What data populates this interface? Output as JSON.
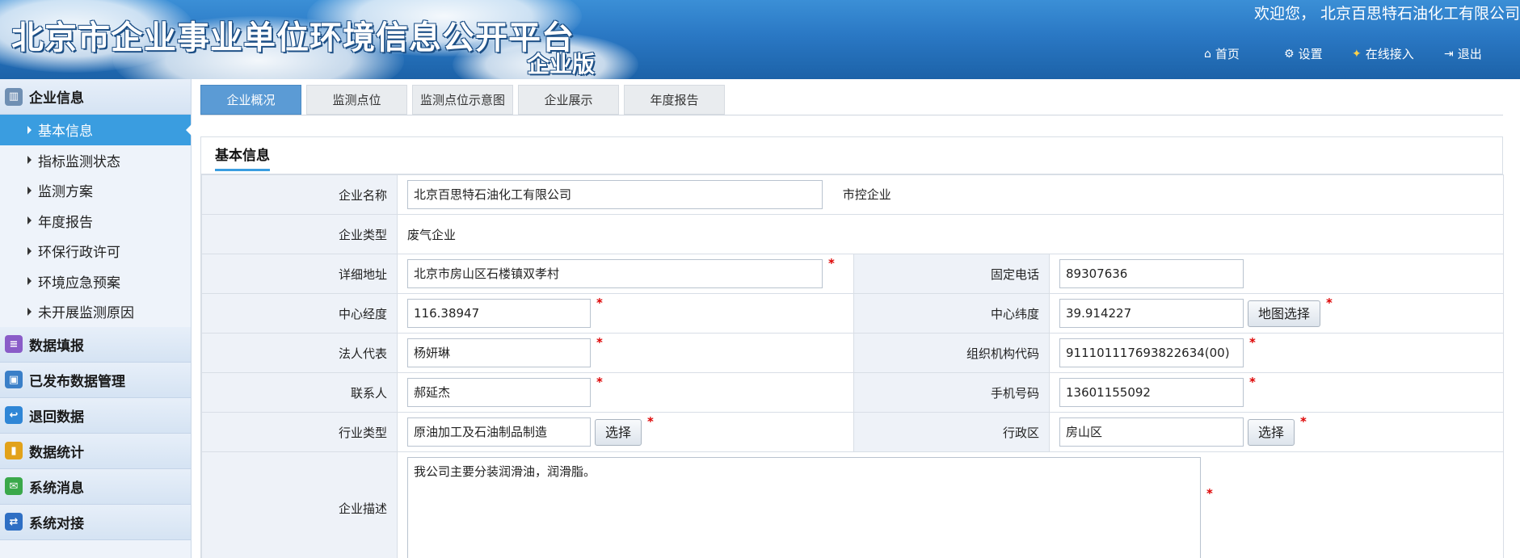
{
  "header": {
    "title": "北京市企业事业单位环境信息公开平台",
    "subtitle": "企业版",
    "welcome": "欢迎您， 北京百思特石油化工有限公司",
    "nav": [
      {
        "label": "首页",
        "icon": "home-icon"
      },
      {
        "label": "设置",
        "icon": "gear-icon"
      },
      {
        "label": "在线接入",
        "icon": "online-access-icon"
      },
      {
        "label": "退出",
        "icon": "logout-icon"
      }
    ]
  },
  "sidebar": {
    "sections": [
      {
        "label": "企业信息",
        "icon": "enterprise-info-icon",
        "color": "#6f8fb3"
      },
      {
        "label": "数据填报",
        "icon": "data-report-icon",
        "color": "#8a5cc8"
      },
      {
        "label": "已发布数据管理",
        "icon": "published-data-icon",
        "color": "#3a7fc8"
      },
      {
        "label": "退回数据",
        "icon": "returned-data-icon",
        "color": "#2f86d6"
      },
      {
        "label": "数据统计",
        "icon": "statistics-icon",
        "color": "#e2a21a"
      },
      {
        "label": "系统消息",
        "icon": "message-icon",
        "color": "#3aa84a"
      },
      {
        "label": "系统对接",
        "icon": "system-link-icon",
        "color": "#2f6fc4"
      }
    ],
    "sub_items": [
      {
        "label": "基本信息",
        "active": true
      },
      {
        "label": "指标监测状态",
        "active": false
      },
      {
        "label": "监测方案",
        "active": false
      },
      {
        "label": "年度报告",
        "active": false
      },
      {
        "label": "环保行政许可",
        "active": false
      },
      {
        "label": "环境应急预案",
        "active": false
      },
      {
        "label": "未开展监测原因",
        "active": false
      }
    ]
  },
  "tabs": [
    {
      "label": "企业概况",
      "active": true
    },
    {
      "label": "监测点位",
      "active": false
    },
    {
      "label": "监测点位示意图",
      "active": false
    },
    {
      "label": "企业展示",
      "active": false
    },
    {
      "label": "年度报告",
      "active": false
    }
  ],
  "panel": {
    "title": "基本信息",
    "fields": {
      "company_name": {
        "label": "企业名称",
        "value": "北京百思特石油化工有限公司",
        "extra": "市控企业"
      },
      "company_type": {
        "label": "企业类型",
        "value": "废气企业"
      },
      "address": {
        "label": "详细地址",
        "value": "北京市房山区石楼镇双孝村"
      },
      "phone": {
        "label": "固定电话",
        "value": "89307636"
      },
      "longitude": {
        "label": "中心经度",
        "value": "116.38947"
      },
      "latitude": {
        "label": "中心纬度",
        "value": "39.914227",
        "button": "地图选择"
      },
      "legal_rep": {
        "label": "法人代表",
        "value": "杨妍琳"
      },
      "org_code": {
        "label": "组织机构代码",
        "value": "911101117693822634(00)"
      },
      "contact": {
        "label": "联系人",
        "value": "郝延杰"
      },
      "mobile": {
        "label": "手机号码",
        "value": "13601155092"
      },
      "industry": {
        "label": "行业类型",
        "value": "原油加工及石油制品制造",
        "button": "选择"
      },
      "district": {
        "label": "行政区",
        "value": "房山区",
        "button": "选择"
      },
      "description": {
        "label": "企业描述",
        "value": "我公司主要分装润滑油，润滑脂。"
      }
    },
    "required_mark": "*"
  }
}
